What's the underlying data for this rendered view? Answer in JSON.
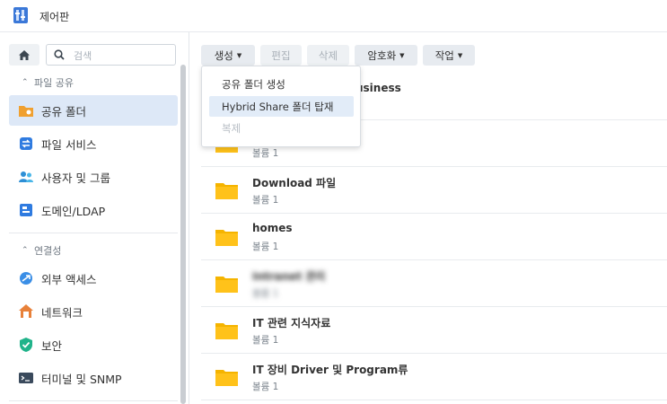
{
  "window": {
    "title": "제어판"
  },
  "sidebar": {
    "search_placeholder": "검색",
    "sections": [
      {
        "label": "파일 공유"
      },
      {
        "label": "연결성"
      }
    ],
    "items": [
      {
        "label": "공유 폴더",
        "active": true,
        "icon": "shared-folder-icon"
      },
      {
        "label": "파일 서비스",
        "icon": "file-services-icon"
      },
      {
        "label": "사용자 및 그룹",
        "icon": "users-icon"
      },
      {
        "label": "도메인/LDAP",
        "icon": "domain-icon"
      },
      {
        "label": "외부 액세스",
        "icon": "external-access-icon"
      },
      {
        "label": "네트워크",
        "icon": "network-icon"
      },
      {
        "label": "보안",
        "icon": "security-icon"
      },
      {
        "label": "터미널 및 SNMP",
        "icon": "terminal-icon"
      }
    ]
  },
  "toolbar": {
    "create": "생성",
    "edit": "편집",
    "delete": "삭제",
    "encryption": "암호화",
    "action": "작업"
  },
  "create_menu": {
    "items": [
      "공유 폴더 생성",
      "Hybrid Share 폴더 탑재",
      "복제"
    ]
  },
  "folders": [
    {
      "name": "usiness",
      "sub": ""
    },
    {
      "name": "",
      "sub": "볼륨 1"
    },
    {
      "name": "Download 파일",
      "sub": "볼륨 1"
    },
    {
      "name": "homes",
      "sub": "볼륨 1"
    },
    {
      "name": "Intranet 관리",
      "sub": "볼륨 1"
    },
    {
      "name": "IT 관련 지식자료",
      "sub": "볼륨 1"
    },
    {
      "name": "IT 장비 Driver 및 Program류",
      "sub": "볼륨 1"
    }
  ],
  "colors": {
    "accent": "#dde8f7",
    "folder": "#f5b400"
  }
}
